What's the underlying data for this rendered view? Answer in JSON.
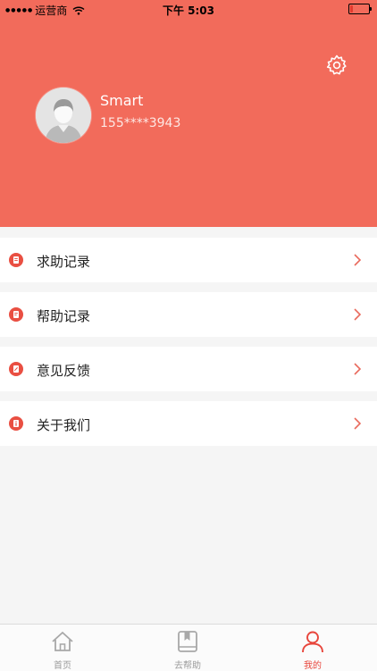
{
  "status_bar": {
    "carrier": "运营商",
    "time": "下午 5:03",
    "battery_level": 0.15
  },
  "profile": {
    "name": "Smart",
    "phone": "155****3943"
  },
  "menu": [
    {
      "label": "求助记录",
      "icon": "document-icon"
    },
    {
      "label": "帮助记录",
      "icon": "document-icon"
    },
    {
      "label": "意见反馈",
      "icon": "feedback-icon"
    },
    {
      "label": "关于我们",
      "icon": "info-icon"
    }
  ],
  "tabs": [
    {
      "label": "首页",
      "icon": "home-icon",
      "active": false
    },
    {
      "label": "去帮助",
      "icon": "bookmark-book-icon",
      "active": false
    },
    {
      "label": "我的",
      "icon": "person-icon",
      "active": true
    }
  ],
  "colors": {
    "accent": "#f26b5b",
    "tab_active": "#e8463c",
    "tab_inactive": "#9b9b9b"
  }
}
